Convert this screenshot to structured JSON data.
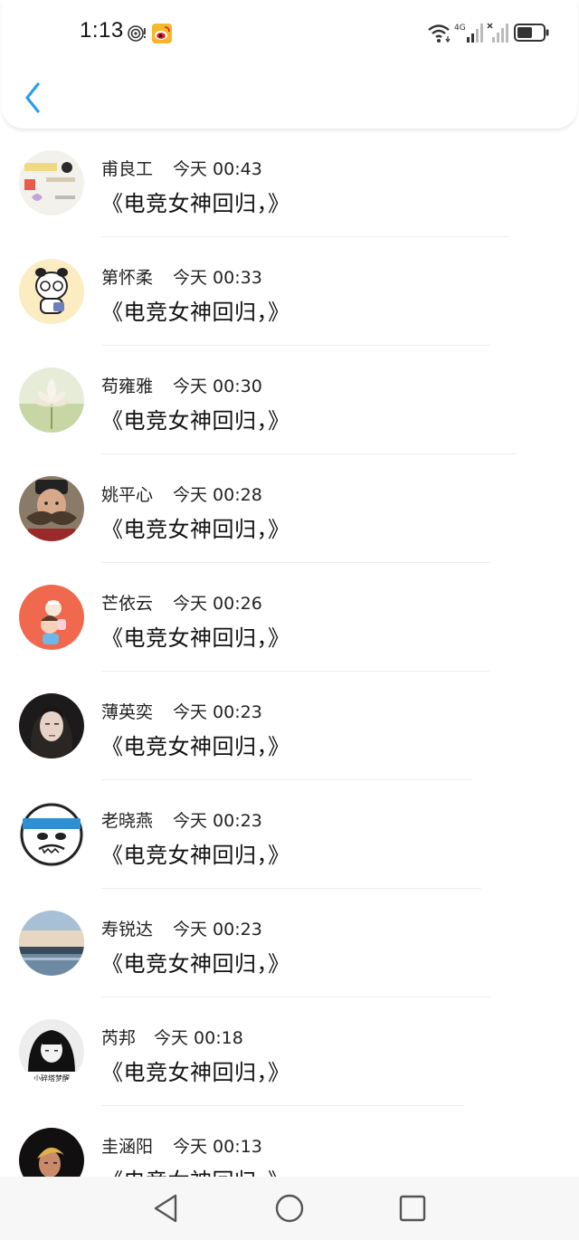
{
  "status_bar": {
    "time": "1:13",
    "icons": [
      "hotspot-icon",
      "weibo-icon",
      "wifi-icon",
      "signal-4g-icon",
      "signal-icon",
      "battery-icon"
    ],
    "network_label": "4G"
  },
  "nav": {
    "back_icon": "chevron-left-icon",
    "accent_color": "#2a9ee8"
  },
  "comments": [
    {
      "name": "甫良工",
      "time": "今天 00:43",
      "text": "《电竞女神回归，》",
      "avatar": "sticker-avatar"
    },
    {
      "name": "第怀柔",
      "time": "今天 00:33",
      "text": "《电竞女神回归，》",
      "avatar": "panda-cartoon-avatar"
    },
    {
      "name": "苟雍雅",
      "time": "今天 00:30",
      "text": "《电竞女神回归，》",
      "avatar": "lotus-avatar"
    },
    {
      "name": "姚平心",
      "time": "今天 00:28",
      "text": "《电竞女神回归，》",
      "avatar": "mustache-man-avatar"
    },
    {
      "name": "芒依云",
      "time": "今天 00:26",
      "text": "《电竞女神回归，》",
      "avatar": "cartoon-kids-avatar"
    },
    {
      "name": "薄英奕",
      "time": "今天 00:23",
      "text": "《电竞女神回归，》",
      "avatar": "woman-portrait-avatar"
    },
    {
      "name": "老晓燕",
      "time": "今天 00:23",
      "text": "《电竞女神回归，》",
      "avatar": "cartoon-face-avatar"
    },
    {
      "name": "寿锐达",
      "time": "今天 00:23",
      "text": "《电竞女神回归，》",
      "avatar": "landscape-avatar"
    },
    {
      "name": "芮邦",
      "time": "今天 00:18",
      "text": "《电竞女神回归，》",
      "avatar": "bw-girl-avatar",
      "caption": "小碎塔梦醒"
    },
    {
      "name": "圭涵阳",
      "time": "今天 00:13",
      "text": "《电竞女神回归，》",
      "avatar": "dark-portrait-avatar"
    }
  ],
  "bottom_nav": {
    "buttons": [
      "nav-back-icon",
      "nav-home-icon",
      "nav-recent-icon"
    ]
  }
}
